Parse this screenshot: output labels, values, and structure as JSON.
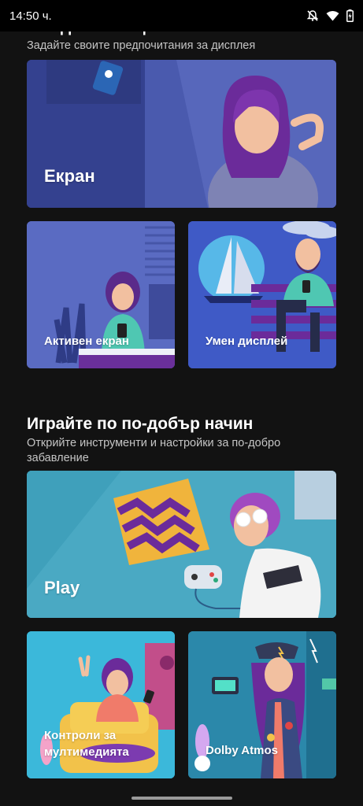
{
  "status_bar": {
    "time": "14:50 ч.",
    "icons": [
      "notifications-off-icon",
      "wifi-icon",
      "battery-icon"
    ]
  },
  "sections": {
    "display": {
      "title": "Виждайте нещата по своя начин",
      "subtitle": "Задайте своите предпочитания за дисплея",
      "cards": {
        "screen": "Екран",
        "active_display": "Активен екран",
        "smart_display": "Умен дисплей"
      }
    },
    "play": {
      "title": "Играйте по по-добър начин",
      "subtitle": "Открийте инструменти и настройки за по-добро забавление",
      "cards": {
        "play": "Play",
        "media_controls": "Контроли за мултимедията",
        "dolby": "Dolby Atmos"
      }
    }
  },
  "colors": {
    "background": "#121212",
    "card_screen": "#3b4a9e",
    "card_active": "#5566bb",
    "card_smart": "#3e59c7",
    "card_play": "#4aa7c0",
    "card_media": "#36b6d8",
    "card_dolby": "#2a86a8"
  }
}
